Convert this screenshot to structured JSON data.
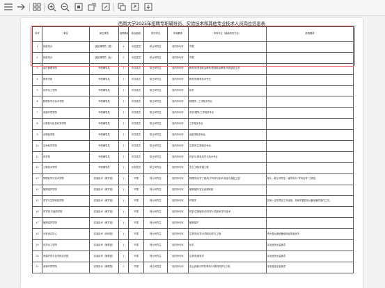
{
  "toolbar": {
    "icons": [
      "menu-icon",
      "forward-icon",
      "sidebar-icon",
      "zoom-in-icon",
      "zoom-out-icon",
      "fit-page-icon",
      "rotate-icon",
      "annotate-icon",
      "copy-icon",
      "export-icon",
      "download-icon"
    ]
  },
  "document": {
    "title": "西南大学2025年招聘专职辅导员、实验技术和其他专业技术人员岗位信息表",
    "headers": [
      "序号",
      "单位",
      "岗位类别",
      "招聘数量",
      "政治面貌",
      "学历学位",
      "学缘要求",
      "学科专业（最高学历专业）",
      "其他要求"
    ],
    "rows": [
      [
        "1",
        "校机构办",
        "团区辅导员（男）",
        "4",
        "中共党员",
        "硕士研究生",
        "校内外均可",
        "不限",
        ""
      ],
      [
        "2",
        "校机构办",
        "团区辅导员（女）",
        "2",
        "中共党员",
        "硕士研究生",
        "校内外均可",
        "不限",
        ""
      ],
      [
        "3",
        "经济管理学院",
        "专职辅导员",
        "1",
        "中共党员",
        "硕士研究生",
        "校内外均可",
        "教育学/思想政治教育/思想政治教育/中国语言文学",
        ""
      ],
      [
        "4",
        "教育学部",
        "专职辅导员",
        "1",
        "中共党员",
        "硕士研究生",
        "校内外均可",
        "教育学/教育技术专业",
        ""
      ],
      [
        "5",
        "化学化工学院",
        "专职辅导员",
        "1",
        "中共党员",
        "硕士研究生",
        "校内外均可",
        "化学",
        ""
      ],
      [
        "6",
        "物理科学与技术学院",
        "专职辅导员",
        "1",
        "中共党员",
        "硕士研究生",
        "校内外均可",
        "物理学、工学相关专业",
        ""
      ],
      [
        "7",
        "资源环境学院",
        "专职辅导员",
        "1",
        "中共党员",
        "硕士研究生",
        "校内外均可",
        "农学/理学/工学相关专业",
        ""
      ],
      [
        "8",
        "计算机与信息科学学院",
        "专职辅导员",
        "1",
        "中共党员",
        "硕士研究生",
        "校内外均可",
        "工学相关专业",
        ""
      ],
      [
        "9",
        "动物医学院",
        "专职辅导员",
        "1",
        "中共党员",
        "硕士研究生",
        "校内外均可",
        "兽医学相关专业",
        ""
      ],
      [
        "10",
        "生命科学学院",
        "专职辅导员",
        "1",
        "中共党员",
        "硕士研究生",
        "校内外均可",
        "生物学/生物相关专业",
        ""
      ],
      [
        "11",
        "药学院",
        "专职辅导员",
        "1",
        "中共党员",
        "硕士研究生",
        "校内外均可",
        "药学/计算机科学与技术专业",
        ""
      ],
      [
        "12",
        "工程技术学院",
        "专职辅导员",
        "1",
        "中共党员",
        "硕士研究生",
        "校内外均可",
        "农业工程/机械工程",
        ""
      ],
      [
        "13",
        "物理科学与技术学院",
        "实验技术（教学型）",
        "1",
        "不限",
        "博士研究生",
        "校内外均可",
        "物理学/化学工程/电子科学与技术/信息与通信工程",
        "硕士、硕士研究生一级学科为“学科名称”之规定。"
      ],
      [
        "14",
        "植物保护学院",
        "实验技术（教学型）",
        "1",
        "不限",
        "博士研究生",
        "校内外均可",
        "植物保护/农业资源利用",
        ""
      ],
      [
        "15",
        "农学与生物科技学院",
        "实验技术（教学型）",
        "1",
        "不限",
        "博士研究生",
        "校内外均可",
        "作物学",
        "具有一定的项目工作经验，熟练掌握实验仪器设备的操作工艺。"
      ],
      [
        "16",
        "药学院 中医药学院",
        "实验技术（教学型）",
        "1",
        "不限",
        "博士研究生",
        "校内外均可",
        "药学/生物医药/中药学/计算机科学与技术",
        ""
      ],
      [
        "17",
        "植物保护学院",
        "实验技术（教学型）",
        "1",
        "不限",
        "博士研究生",
        "校内外均可",
        "植物保护",
        ""
      ],
      [
        "18",
        "分析测试中心",
        "实验技术（科研型）",
        "1",
        "不限",
        "博士研究生",
        "校内外均可",
        "生物学/化学/计算机科学与工程",
        "有大型仪器设备使用经验者优先"
      ],
      [
        "19",
        "化学化工学院",
        "实验技术（管理型）",
        "1",
        "不限",
        "博士研究生",
        "校内外均可",
        "化学",
        "实验室安全监管员"
      ],
      [
        "20",
        "资源环境与化学科技学院",
        "实验技术（管理型）",
        "1",
        "不限",
        "博士研究生",
        "校内外均可",
        "生物学/畜牧学",
        "实验室安全监管员"
      ],
      [
        "21",
        "资源环境学院",
        "实验技术（管理型）",
        "1",
        "不限",
        "博士研究生",
        "校内外均可",
        "农业资源与环境/林学/计算机科学与工程",
        "实验室安全监管员"
      ]
    ]
  },
  "highlight": {
    "color": "#e45a5a"
  }
}
